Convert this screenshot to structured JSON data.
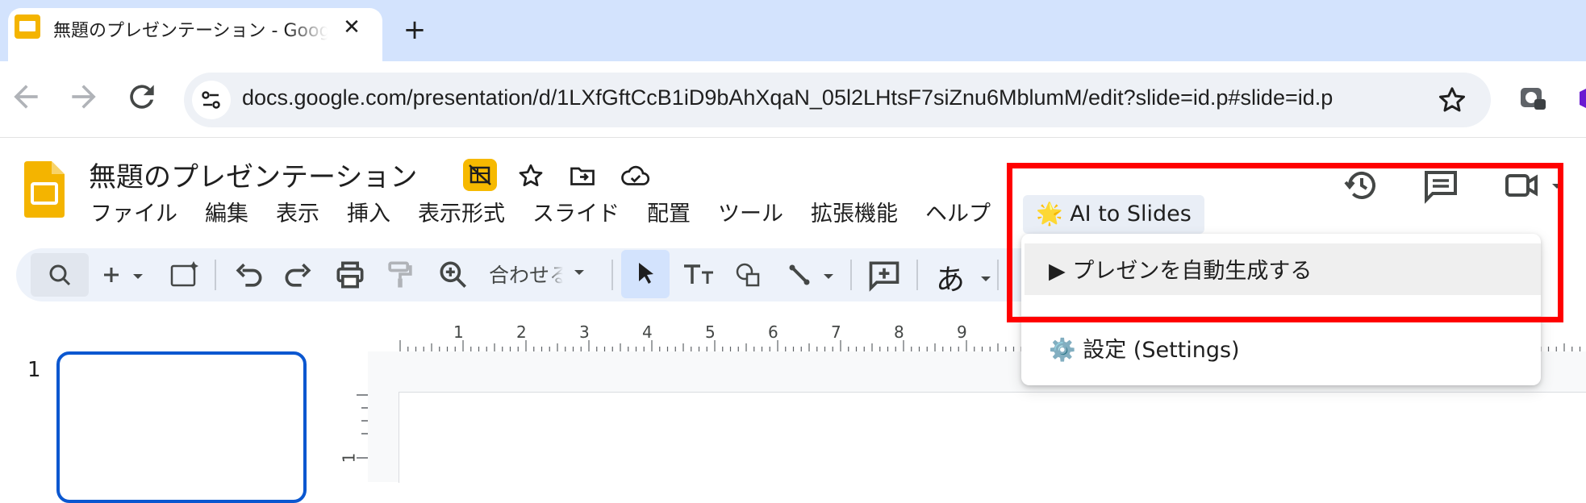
{
  "browser": {
    "tab_title": "無題のプレゼンテーション - Google スライド",
    "tab_close": "✕",
    "new_tab": "+",
    "url": "docs.google.com/presentation/d/1LXfGftCcB1iD9bAhXqaN_05l2LHtsF7siZnu6MblumM/edit?slide=id.p#slide=id.p"
  },
  "doc": {
    "title": "無題のプレゼンテーション"
  },
  "menu": {
    "items": [
      "ファイル",
      "編集",
      "表示",
      "挿入",
      "表示形式",
      "スライド",
      "配置",
      "ツール",
      "拡張機能",
      "ヘルプ"
    ],
    "ai_to_slides": "🌟 AI to Slides"
  },
  "toolbar": {
    "zoom": "合わせる",
    "font_glyph": "あ"
  },
  "ruler": {
    "top_labels": [
      "1",
      "2",
      "3",
      "4",
      "5",
      "6",
      "7",
      "8",
      "9"
    ],
    "left_labels": [
      "1"
    ]
  },
  "filmstrip": {
    "slide_number": "1"
  },
  "dropdown": {
    "generate": "▶ プレゼンを自動生成する",
    "settings": "⚙️ 設定 (Settings)"
  },
  "colors": {
    "accent_blue": "#0b57d0",
    "highlight_red": "#ff0000",
    "slides_yellow": "#f4b400"
  }
}
